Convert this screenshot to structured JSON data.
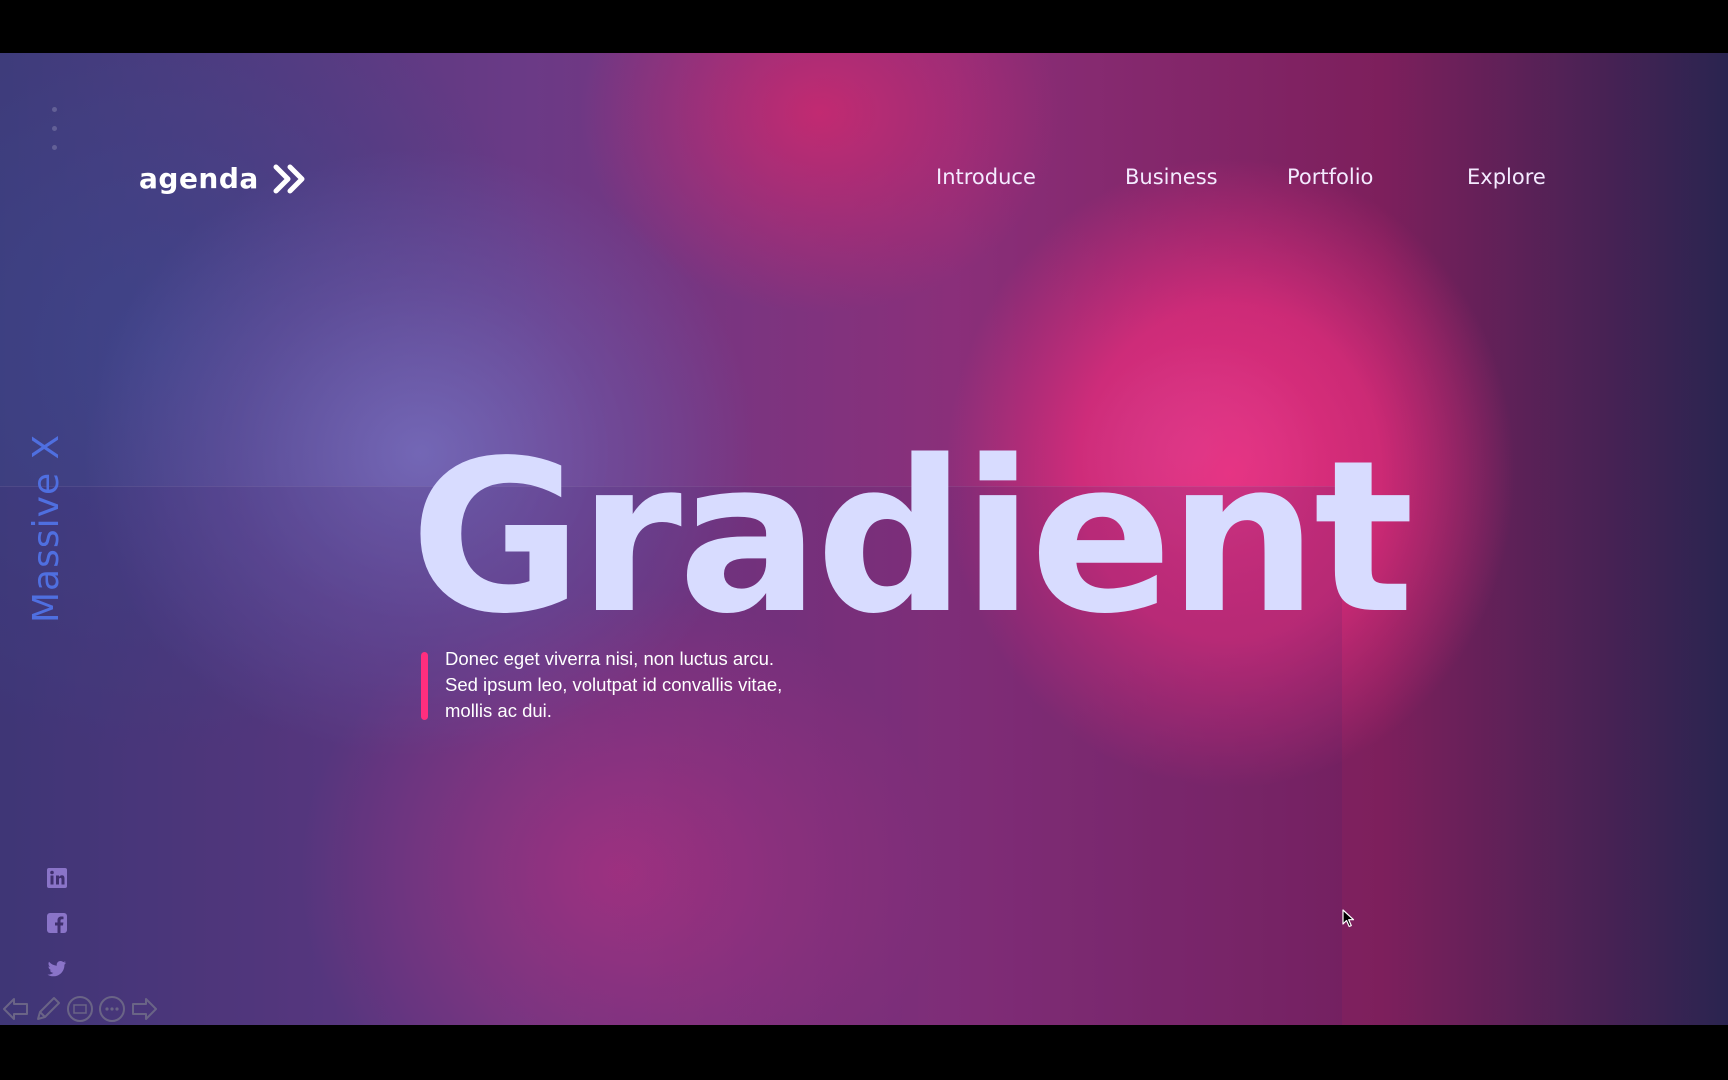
{
  "header": {
    "logo_text": "agenda",
    "nav": [
      "Introduce",
      "Business",
      "Portfolio",
      "Explore"
    ]
  },
  "sidebar": {
    "brand": "Massive X",
    "social_icons": [
      "linkedin-icon",
      "facebook-icon",
      "twitter-icon"
    ]
  },
  "hero": {
    "title": "Gradient",
    "body_lines": [
      "Donec eget viverra nisi, non luctus arcu.",
      "Sed ipsum leo, volutpat id convallis vitae,",
      "mollis ac dui."
    ]
  },
  "toolbar": {
    "icons": [
      "previous-slide-icon",
      "pen-icon",
      "slides-grid-icon",
      "more-options-icon",
      "next-slide-icon"
    ]
  },
  "colors": {
    "title": "#d8dcff",
    "accent": "#ff2e7e",
    "brand": "#4f6fe0",
    "nav_text": "#f4eaff"
  }
}
